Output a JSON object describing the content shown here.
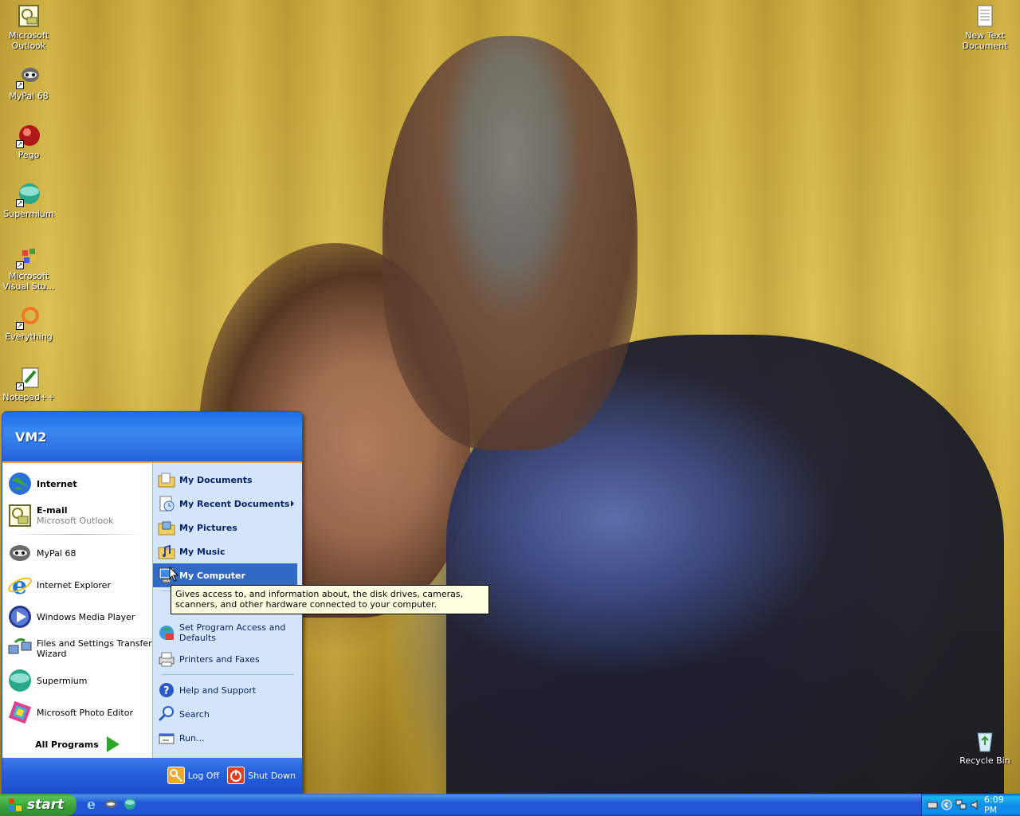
{
  "desktop": {
    "left_icons": [
      {
        "label": "Microsoft Outlook",
        "icon": "outlook-icon"
      },
      {
        "label": "MyPal 68",
        "icon": "mypal-icon"
      },
      {
        "label": "Pego",
        "icon": "pego-icon"
      },
      {
        "label": "Supermium",
        "icon": "supermium-icon"
      },
      {
        "label": "Microsoft Visual Stu...",
        "icon": "visual-studio-icon"
      },
      {
        "label": "Everything",
        "icon": "everything-icon"
      },
      {
        "label": "Notepad++",
        "icon": "notepadpp-icon"
      }
    ],
    "right_icons": [
      {
        "label": "New Text Document",
        "icon": "text-document-icon"
      },
      {
        "label": "Recycle Bin",
        "icon": "recycle-bin-icon"
      }
    ]
  },
  "start_menu": {
    "user": "VM2",
    "pinned": [
      {
        "title": "Internet",
        "subtitle": "",
        "icon": "globe-icon"
      },
      {
        "title": "E-mail",
        "subtitle": "Microsoft Outlook",
        "icon": "outlook-icon"
      }
    ],
    "recent": [
      {
        "title": "MyPal 68",
        "icon": "mypal-icon"
      },
      {
        "title": "Internet Explorer",
        "icon": "internet-explorer-icon"
      },
      {
        "title": "Windows Media Player",
        "icon": "media-player-icon"
      },
      {
        "title": "Files and Settings Transfer Wizard",
        "icon": "transfer-wizard-icon"
      },
      {
        "title": "Supermium",
        "icon": "supermium-icon"
      },
      {
        "title": "Microsoft Photo Editor",
        "icon": "photo-editor-icon"
      }
    ],
    "all_programs": "All Programs",
    "places": [
      {
        "label": "My Documents",
        "icon": "folder-documents-icon"
      },
      {
        "label": "My Recent Documents",
        "icon": "recent-documents-icon"
      },
      {
        "label": "My Pictures",
        "icon": "folder-pictures-icon"
      },
      {
        "label": "My Music",
        "icon": "folder-music-icon"
      },
      {
        "label": "My Computer",
        "icon": "my-computer-icon"
      }
    ],
    "settings": [
      {
        "label": "Set Program Access and Defaults",
        "icon": "program-access-icon"
      },
      {
        "label": "Printers and Faxes",
        "icon": "printer-icon"
      }
    ],
    "help": [
      {
        "label": "Help and Support",
        "icon": "help-icon"
      },
      {
        "label": "Search",
        "icon": "search-icon"
      },
      {
        "label": "Run...",
        "icon": "run-icon"
      }
    ],
    "log_off": "Log Off",
    "shut_down": "Shut Down",
    "tooltip": "Gives access to, and information about, the disk drives, cameras, scanners, and other hardware connected to your computer."
  },
  "taskbar": {
    "start_label": "start",
    "clock": "6:09 PM"
  },
  "colors": {
    "start_menu_header": "#2462d8",
    "selection": "#316ac5",
    "start_button": "#3a9f3a",
    "taskbar": "#2157d7",
    "tooltip_bg": "#ffffe1"
  }
}
